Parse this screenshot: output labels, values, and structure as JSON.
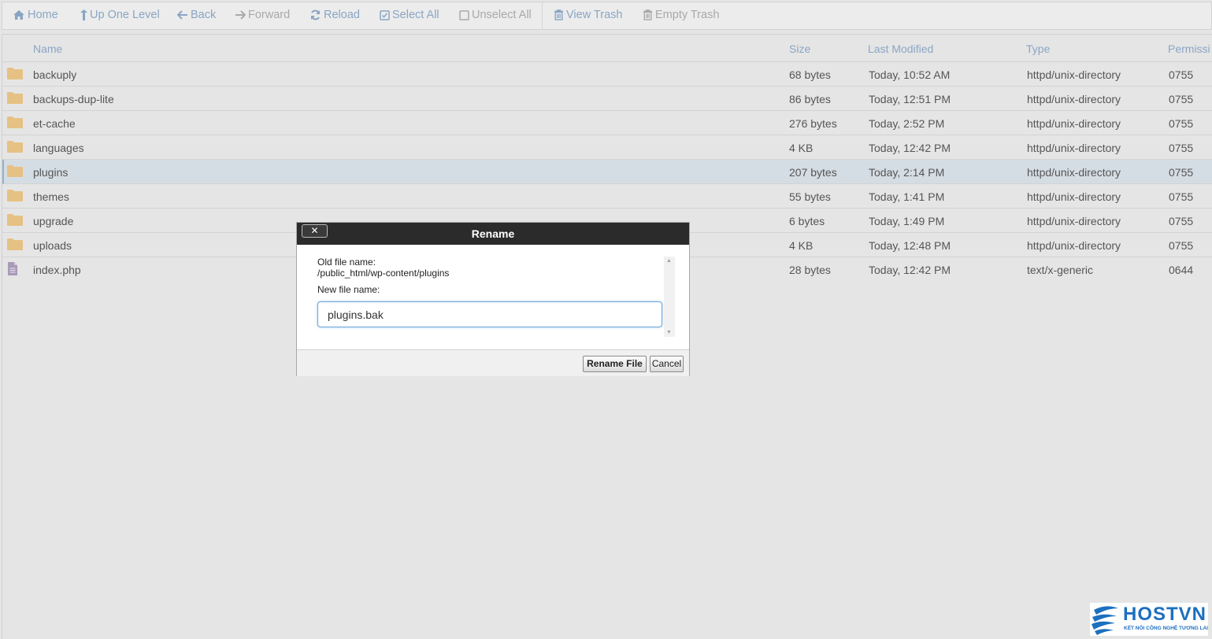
{
  "toolbar": {
    "home": "Home",
    "up_one_level": "Up One Level",
    "back": "Back",
    "forward": "Forward",
    "reload": "Reload",
    "select_all": "Select All",
    "unselect_all": "Unselect All",
    "view_trash": "View Trash",
    "empty_trash": "Empty Trash"
  },
  "table": {
    "columns": {
      "name": "Name",
      "size": "Size",
      "last_modified": "Last Modified",
      "type": "Type",
      "permissions": "Permissi"
    },
    "rows": [
      {
        "name": "backuply",
        "size": "68 bytes",
        "modified": "Today, 10:52 AM",
        "type": "httpd/unix-directory",
        "perms": "0755",
        "icon": "folder-icon"
      },
      {
        "name": "backups-dup-lite",
        "size": "86 bytes",
        "modified": "Today, 12:51 PM",
        "type": "httpd/unix-directory",
        "perms": "0755",
        "icon": "folder-icon"
      },
      {
        "name": "et-cache",
        "size": "276 bytes",
        "modified": "Today, 2:52 PM",
        "type": "httpd/unix-directory",
        "perms": "0755",
        "icon": "folder-icon"
      },
      {
        "name": "languages",
        "size": "4 KB",
        "modified": "Today, 12:42 PM",
        "type": "httpd/unix-directory",
        "perms": "0755",
        "icon": "folder-icon"
      },
      {
        "name": "plugins",
        "size": "207 bytes",
        "modified": "Today, 2:14 PM",
        "type": "httpd/unix-directory",
        "perms": "0755",
        "icon": "folder-icon",
        "selected": true
      },
      {
        "name": "themes",
        "size": "55 bytes",
        "modified": "Today, 1:41 PM",
        "type": "httpd/unix-directory",
        "perms": "0755",
        "icon": "folder-icon"
      },
      {
        "name": "upgrade",
        "size": "6 bytes",
        "modified": "Today, 1:49 PM",
        "type": "httpd/unix-directory",
        "perms": "0755",
        "icon": "folder-icon"
      },
      {
        "name": "uploads",
        "size": "4 KB",
        "modified": "Today, 12:48 PM",
        "type": "httpd/unix-directory",
        "perms": "0755",
        "icon": "folder-icon"
      },
      {
        "name": "index.php",
        "size": "28 bytes",
        "modified": "Today, 12:42 PM",
        "type": "text/x-generic",
        "perms": "0644",
        "icon": "file-icon"
      }
    ]
  },
  "dialog": {
    "title": "Rename",
    "close_label": "✕",
    "old_label": "Old file name:",
    "old_path": "/public_html/wp-content/plugins",
    "new_label": "New file name:",
    "new_value": "plugins.bak",
    "rename_button": "Rename File",
    "cancel_button": "Cancel"
  },
  "logo": {
    "name": "HOSTVN",
    "tagline": "KẾT NỐI CÔNG NGHỆ TƯƠNG LAI"
  },
  "colors": {
    "accent": "#8aa5c4",
    "folder": "#e6c184",
    "selected_row": "#d5dde4",
    "dialog_header": "#2b2b2b",
    "logo": "#1d6fc0"
  }
}
